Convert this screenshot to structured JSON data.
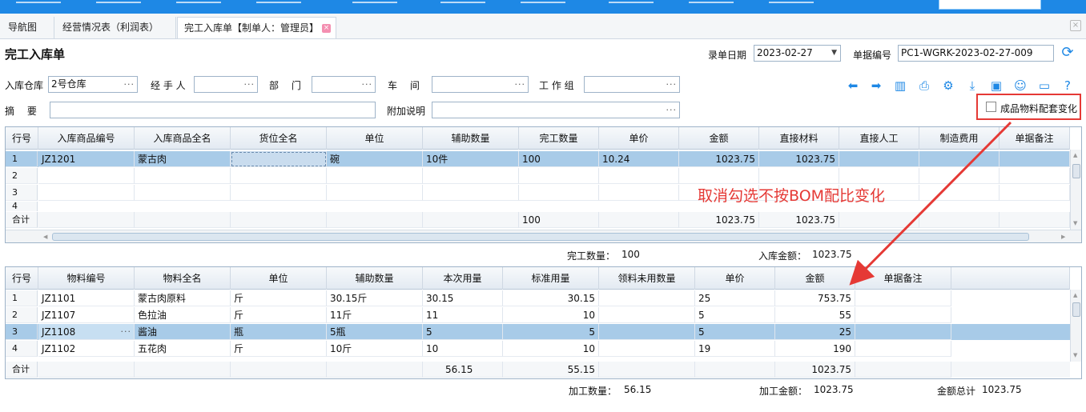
{
  "tabs": [
    {
      "label": "导航图"
    },
    {
      "label": "经营情况表（利润表）"
    },
    {
      "label": "完工入库单【制单人：管理员】"
    }
  ],
  "page_title": "完工入库单",
  "header": {
    "date_label": "录单日期",
    "date_value": "2023-02-27",
    "docno_label": "单据编号",
    "docno_value": "PC1-WGRK-2023-02-27-009"
  },
  "form": {
    "warehouse_label": "入库仓库",
    "warehouse_value": "2号仓库",
    "handler_label": "经 手 人",
    "dept_label": "部　 门",
    "workshop_label": "车　 间",
    "workgroup_label": "工 作 组",
    "summary_label": "摘　 要",
    "extra_label": "附加说明"
  },
  "checkbox_label": "成品物料配套变化",
  "annotation": "取消勾选不按BOM配比变化",
  "top_grid": {
    "headers": [
      "行号",
      "入库商品编号",
      "入库商品全名",
      "货位全名",
      "单位",
      "辅助数量",
      "完工数量",
      "单价",
      "金额",
      "直接材料",
      "直接人工",
      "制造费用",
      "单据备注"
    ],
    "rows": [
      {
        "num": "1",
        "code": "JZ1201",
        "name": "蒙古肉",
        "loc": "",
        "unit": "碗",
        "aux": "10件",
        "qty": "100",
        "price": "10.24",
        "amount": "1023.75",
        "material": "1023.75",
        "labor": "",
        "overhead": "",
        "note": ""
      },
      {
        "num": "2"
      },
      {
        "num": "3"
      },
      {
        "num": "4"
      }
    ],
    "total": {
      "label": "合计",
      "qty": "100",
      "amount": "1023.75",
      "material": "1023.75"
    }
  },
  "top_summary": {
    "qty_label": "完工数量：",
    "qty_value": "100",
    "amount_label": "入库金额：",
    "amount_value": "1023.75"
  },
  "bottom_grid": {
    "headers": [
      "行号",
      "物料编号",
      "物料全名",
      "单位",
      "辅助数量",
      "本次用量",
      "标准用量",
      "领料未用数量",
      "单价",
      "金额",
      "单据备注"
    ],
    "rows": [
      {
        "num": "1",
        "code": "JZ1101",
        "name": "蒙古肉原料",
        "unit": "斤",
        "aux": "30.15斤",
        "use": "30.15",
        "std": "30.15",
        "unused": "",
        "price": "25",
        "amount": "753.75",
        "note": ""
      },
      {
        "num": "2",
        "code": "JZ1107",
        "name": "色拉油",
        "unit": "斤",
        "aux": "11斤",
        "use": "11",
        "std": "10",
        "unused": "",
        "price": "5",
        "amount": "55",
        "note": ""
      },
      {
        "num": "3",
        "code": "JZ1108",
        "name": "酱油",
        "unit": "瓶",
        "aux": "5瓶",
        "use": "5",
        "std": "5",
        "unused": "",
        "price": "5",
        "amount": "25",
        "note": ""
      },
      {
        "num": "4",
        "code": "JZ1102",
        "name": "五花肉",
        "unit": "斤",
        "aux": "10斤",
        "use": "10",
        "std": "10",
        "unused": "",
        "price": "19",
        "amount": "190",
        "note": ""
      }
    ],
    "total": {
      "label": "合计",
      "use": "56.15",
      "std": "55.15",
      "amount": "1023.75"
    }
  },
  "bottom_summary": {
    "qty_label": "加工数量：",
    "qty_value": "56.15",
    "amount_label": "加工金额：",
    "amount_value": "1023.75",
    "total_label": "金额总计",
    "total_value": "1023.75"
  },
  "icons": [
    "arrow-left-icon",
    "arrow-right-icon",
    "barcode-icon",
    "print-icon",
    "settings-doc-icon",
    "download-icon",
    "save-icon",
    "user-icon",
    "folder-icon",
    "help-icon",
    "refresh-icon"
  ],
  "colors": {
    "accent": "#1e88e5",
    "selected_row": "#a8cbe8",
    "annotation": "#e53935"
  }
}
